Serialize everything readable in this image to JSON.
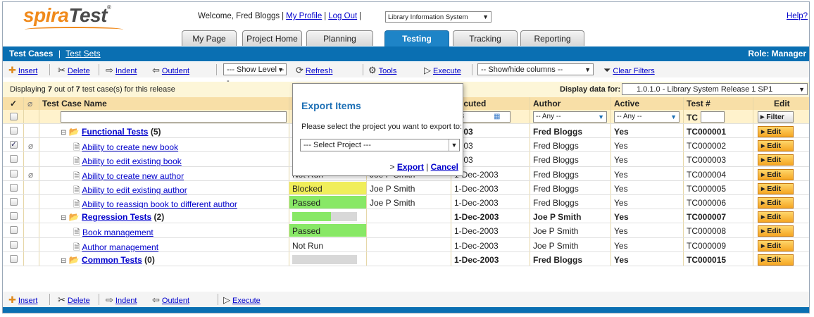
{
  "header": {
    "logo_part1": "spira",
    "logo_part2": "Test",
    "logo_reg": "®",
    "welcome": "Welcome, Fred Bloggs",
    "my_profile": "My Profile",
    "log_out": "Log Out",
    "project": "Library Information System",
    "help": "Help?"
  },
  "tabs": [
    "My Page",
    "Project Home",
    "Planning",
    "Testing",
    "Tracking",
    "Reporting"
  ],
  "active_tab": "Testing",
  "subnav": {
    "test_cases": "Test Cases",
    "separator": "|",
    "test_sets": "Test Sets",
    "role": "Role: Manager"
  },
  "toolbar": {
    "insert": "Insert",
    "delete": "Delete",
    "indent": "Indent",
    "outdent": "Outdent",
    "show_level": "--- Show Level ---",
    "refresh": "Refresh",
    "tools": "Tools",
    "execute": "Execute",
    "show_hide": "-- Show/hide columns --",
    "clear_filters": "Clear Filters"
  },
  "info": {
    "displaying_prefix": "Displaying ",
    "shown": "7",
    "out_of": " out of ",
    "total": "7",
    "suffix": " test case(s) for this release",
    "display_for": "Display data for:",
    "release": "1.0.1.0 - Library System Release 1 SP1"
  },
  "columns": {
    "check": "✓",
    "name": "Test Case Name",
    "executed": "xecuted",
    "author": "Author",
    "active": "Active",
    "test_num": "Test #",
    "edit": "Edit"
  },
  "filters": {
    "date": "03",
    "author": "-- Any --",
    "active": "-- Any --",
    "test_prefix": "TC",
    "filter_button": "Filter"
  },
  "rows": [
    {
      "indent": 0,
      "type": "folder",
      "name": "Functional Tests",
      "count": "(5)",
      "status": "",
      "owner": "",
      "executed": "2003",
      "author": "Fred Bloggs",
      "active": "Yes",
      "id": "TC000001",
      "checked": false,
      "attach": false
    },
    {
      "indent": 1,
      "type": "test",
      "name": "Ability to create new book",
      "count": "",
      "status": "",
      "owner": "",
      "executed": "2003",
      "author": "Fred Bloggs",
      "active": "Yes",
      "id": "TC000002",
      "checked": true,
      "attach": true
    },
    {
      "indent": 1,
      "type": "test",
      "name": "Ability to edit existing book",
      "count": "",
      "status": "",
      "owner": "",
      "executed": "2003",
      "author": "Fred Bloggs",
      "active": "Yes",
      "id": "TC000003",
      "checked": false,
      "attach": false
    },
    {
      "indent": 1,
      "type": "test",
      "name": "Ability to create new author",
      "count": "",
      "status": "Not Run",
      "owner": "Joe P Smith",
      "executed": "1-Dec-2003",
      "author": "Fred Bloggs",
      "active": "Yes",
      "id": "TC000004",
      "checked": false,
      "attach": true
    },
    {
      "indent": 1,
      "type": "test",
      "name": "Ability to edit existing author",
      "count": "",
      "status": "Blocked",
      "owner": "Joe P Smith",
      "executed": "1-Dec-2003",
      "author": "Fred Bloggs",
      "active": "Yes",
      "id": "TC000005",
      "checked": false,
      "attach": false
    },
    {
      "indent": 1,
      "type": "test",
      "name": "Ability to reassign book to different author",
      "count": "",
      "status": "Passed",
      "owner": "Joe P Smith",
      "executed": "1-Dec-2003",
      "author": "Fred Bloggs",
      "active": "Yes",
      "id": "TC000006",
      "checked": false,
      "attach": false
    },
    {
      "indent": 0,
      "type": "folder",
      "name": "Regression Tests",
      "count": "(2)",
      "status": "bar",
      "progress": 0.6,
      "owner": "",
      "executed": "1-Dec-2003",
      "author": "Joe P Smith",
      "active": "Yes",
      "id": "TC000007",
      "checked": false,
      "attach": false
    },
    {
      "indent": 1,
      "type": "test",
      "name": "Book management",
      "count": "",
      "status": "Passed",
      "owner": "",
      "executed": "1-Dec-2003",
      "author": "Joe P Smith",
      "active": "Yes",
      "id": "TC000008",
      "checked": false,
      "attach": false
    },
    {
      "indent": 1,
      "type": "test",
      "name": "Author management",
      "count": "",
      "status": "Not Run",
      "owner": "",
      "executed": "1-Dec-2003",
      "author": "Joe P Smith",
      "active": "Yes",
      "id": "TC000009",
      "checked": false,
      "attach": false
    },
    {
      "indent": 0,
      "type": "folder",
      "name": "Common Tests",
      "count": "(0)",
      "status": "bar",
      "progress": 0.0,
      "owner": "",
      "executed": "1-Dec-2003",
      "author": "Fred Bloggs",
      "active": "Yes",
      "id": "TC000015",
      "checked": false,
      "attach": false
    }
  ],
  "edit_label": "Edit",
  "dialog": {
    "title": "Export Items",
    "message": "Please select the project you want to export to:",
    "select": "--- Select Project ---",
    "export": "Export",
    "separator": "|",
    "cancel": "Cancel",
    "prefix": "> "
  },
  "colors": {
    "brand_blue": "#0a6fb2",
    "header_bg": "#f8dfa7",
    "passed": "#88e866",
    "blocked": "#f0ee5a",
    "edit_button": "#f5a623"
  }
}
